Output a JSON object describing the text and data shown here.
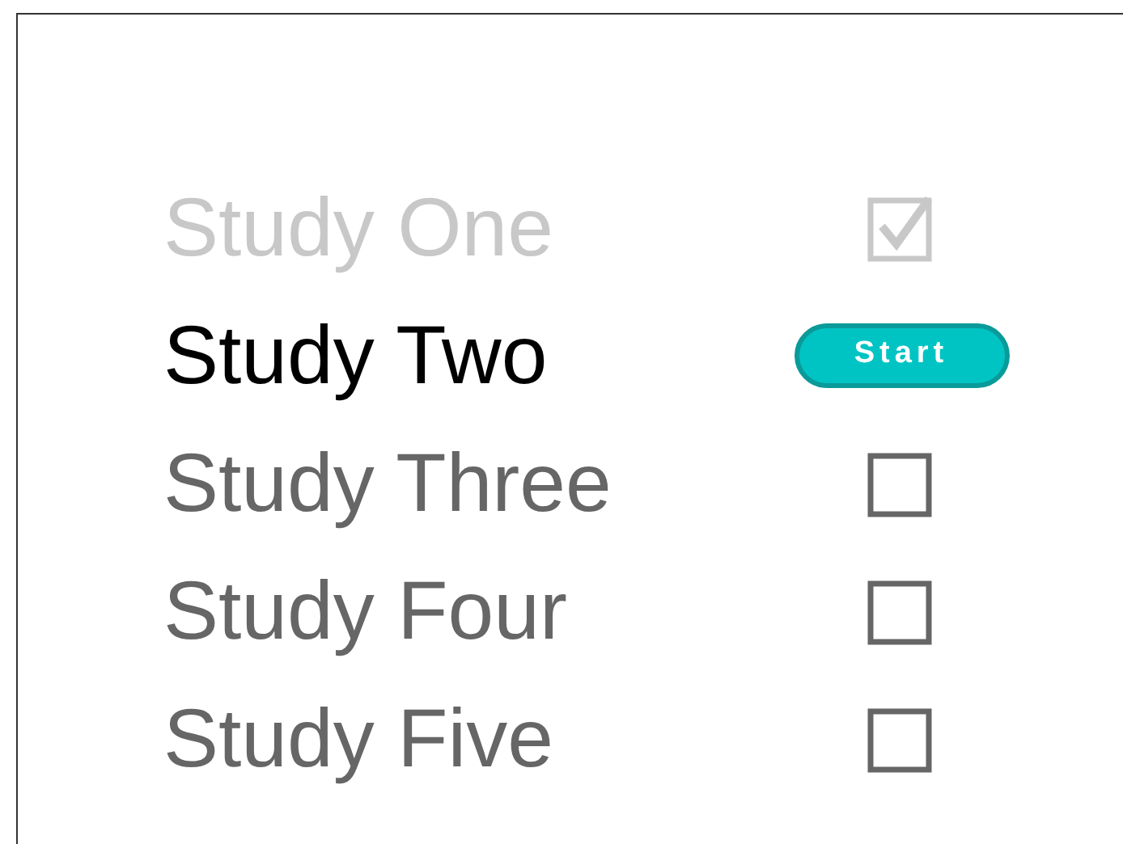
{
  "studies": [
    {
      "label": "Study One",
      "kind": "checkbox",
      "checked": true
    },
    {
      "label": "Study Two",
      "kind": "button",
      "button_label": "Start"
    },
    {
      "label": "Study Three",
      "kind": "checkbox",
      "checked": false
    },
    {
      "label": "Study Four",
      "kind": "checkbox",
      "checked": false
    },
    {
      "label": "Study Five",
      "kind": "checkbox",
      "checked": false
    }
  ]
}
